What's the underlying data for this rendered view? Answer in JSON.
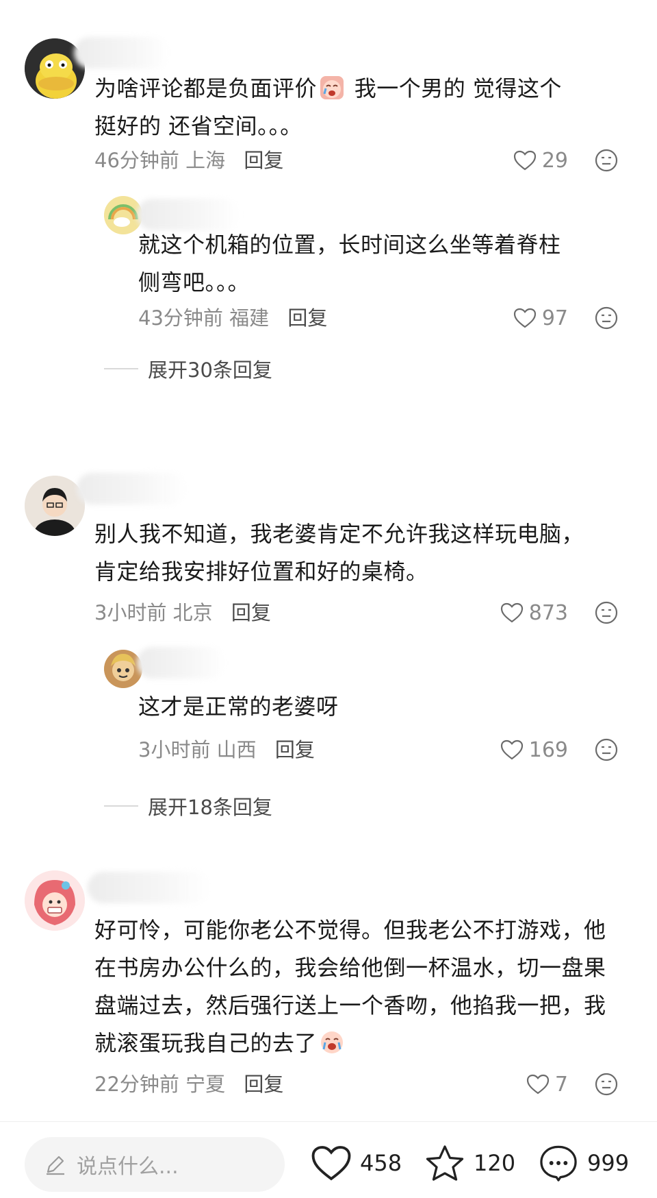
{
  "comments": [
    {
      "text_before_emoji": "为啥评论都是负面评价",
      "text_after_emoji": " 我一个男的 觉得这个挺好的 还省空间。。。",
      "time": "46分钟前",
      "location": "上海",
      "reply_label": "回复",
      "likes": "29",
      "replies": [
        {
          "text": "就这个机箱的位置，长时间这么坐等着脊柱侧弯吧。。。",
          "time": "43分钟前",
          "location": "福建",
          "reply_label": "回复",
          "likes": "97"
        }
      ],
      "expand_label": "展开30条回复"
    },
    {
      "text": "别人我不知道，我老婆肯定不允许我这样玩电脑，肯定给我安排好位置和好的桌椅。",
      "time": "3小时前",
      "location": "北京",
      "reply_label": "回复",
      "likes": "873",
      "replies": [
        {
          "text": "这才是正常的老婆呀",
          "time": "3小时前",
          "location": "山西",
          "reply_label": "回复",
          "likes": "169"
        }
      ],
      "expand_label": "展开18条回复"
    },
    {
      "text": "好可怜，可能你老公不觉得。但我老公不打游戏，他在书房办公什么的，我会给他倒一杯温水，切一盘果盘端过去，然后强行送上一个香吻，他掐我一把，我就滚蛋玩我自己的去了",
      "time": "22分钟前",
      "location": "宁夏",
      "reply_label": "回复",
      "likes": "7"
    }
  ],
  "bottom_bar": {
    "input_placeholder": "说点什么...",
    "likes": "458",
    "favorites": "120",
    "comments": "999"
  },
  "icons": {
    "heart": "heart-icon",
    "dislike": "dislike-face-icon",
    "pencil": "pencil-icon",
    "star": "star-icon",
    "comment": "comment-bubble-icon"
  },
  "colors": {
    "text": "#1a1a1a",
    "meta": "#8a8a8a",
    "reply_link": "#4a4a4a"
  }
}
